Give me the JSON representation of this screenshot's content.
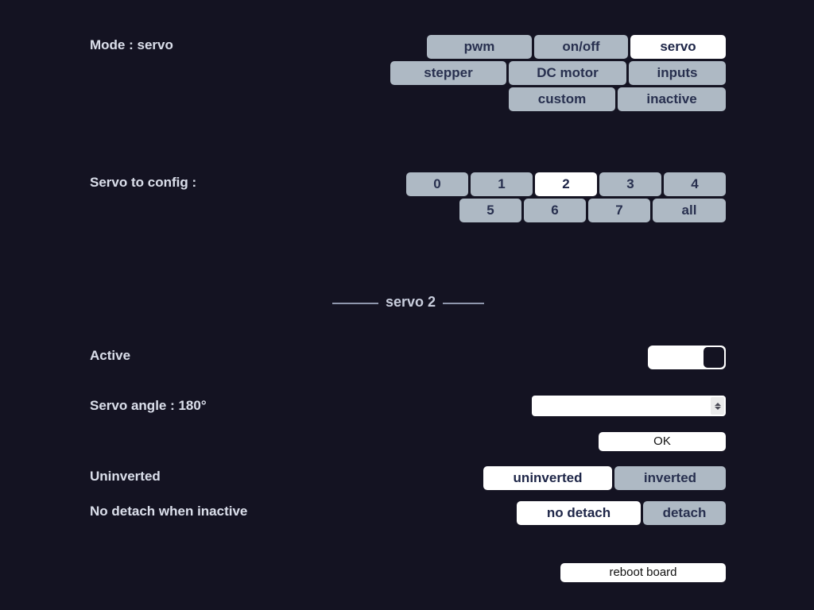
{
  "colors": {
    "background": "#141322",
    "button_idle": "#aeb9c4",
    "button_selected": "#ffffff",
    "button_text": "#28304f",
    "label_text": "#d9dde9"
  },
  "mode": {
    "label": "Mode : servo",
    "selected": "servo",
    "options": [
      {
        "label": "pwm",
        "selected": false
      },
      {
        "label": "on/off",
        "selected": false
      },
      {
        "label": "servo",
        "selected": true
      },
      {
        "label": "stepper",
        "selected": false
      },
      {
        "label": "DC motor",
        "selected": false
      },
      {
        "label": "inputs",
        "selected": false
      },
      {
        "label": "custom",
        "selected": false
      },
      {
        "label": "inactive",
        "selected": false
      }
    ]
  },
  "servo_config": {
    "label": "Servo to config :",
    "selected": "2",
    "options": [
      {
        "label": "0",
        "selected": false
      },
      {
        "label": "1",
        "selected": false
      },
      {
        "label": "2",
        "selected": true
      },
      {
        "label": "3",
        "selected": false
      },
      {
        "label": "4",
        "selected": false
      },
      {
        "label": "5",
        "selected": false
      },
      {
        "label": "6",
        "selected": false
      },
      {
        "label": "7",
        "selected": false
      },
      {
        "label": "all",
        "selected": false
      }
    ]
  },
  "section": {
    "title": "servo 2"
  },
  "active": {
    "label": "Active",
    "state": "on"
  },
  "angle": {
    "label": "Servo angle : 180°",
    "value": "",
    "placeholder": "",
    "spinner_up_icon": "chevron-up-icon",
    "spinner_down_icon": "chevron-down-icon",
    "ok_label": "OK"
  },
  "inverted": {
    "label": "Uninverted",
    "selected": "uninverted",
    "options": [
      {
        "label": "uninverted",
        "selected": true
      },
      {
        "label": "inverted",
        "selected": false
      }
    ]
  },
  "detach": {
    "label": "No detach when inactive",
    "selected": "no detach",
    "options": [
      {
        "label": "no detach",
        "selected": true
      },
      {
        "label": "detach",
        "selected": false
      }
    ]
  },
  "reboot": {
    "label": "reboot board"
  }
}
